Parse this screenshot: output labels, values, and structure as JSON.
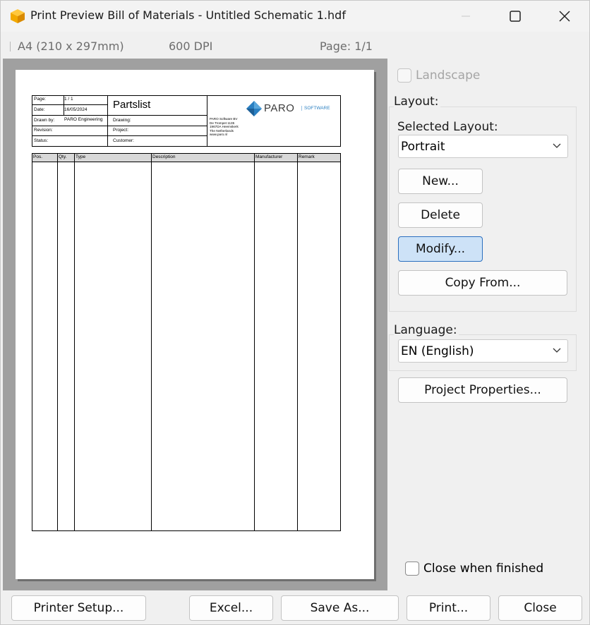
{
  "window": {
    "title": "Print Preview Bill of Materials - Untitled Schematic 1.hdf",
    "controls": {
      "minimize": "minimize-icon",
      "maximize": "maximize-icon",
      "close": "close-icon"
    }
  },
  "info": {
    "paper_size": "A4 (210 x 297mm)",
    "dpi": "600 DPI",
    "page": "Page: 1/1"
  },
  "preview": {
    "header": {
      "page_label": "Page:",
      "page_value": "1   / 1",
      "date_label": "Date:",
      "date_value": "16/05/2024",
      "drawn_label": "Drawn by:",
      "drawn_value": "PARO Engineering",
      "revision_label": "Revision:",
      "status_label": "Status:",
      "title": "Partslist",
      "drawing_label": "Drawing:",
      "project_label": "Project:",
      "customer_label": "Customer:",
      "logo_text": "PARO",
      "logo_sub": "SOFTWARE",
      "address": [
        "PARO Software BV",
        "De Trompet 1135",
        "1967DA Heemskerk",
        "The Netherlands",
        "www.paro.nl"
      ]
    },
    "columns": [
      "Pos.",
      "Qty.",
      "Type",
      "Description",
      "Manufacturer",
      "Remark"
    ]
  },
  "options": {
    "landscape_label": "Landscape",
    "landscape_checked": false,
    "layout_group": "Layout:",
    "selected_layout_label": "Selected Layout:",
    "selected_layout_value": "Portrait",
    "new_label": "New...",
    "delete_label": "Delete",
    "modify_label": "Modify...",
    "copy_from_label": "Copy From...",
    "language_group": "Language:",
    "language_value": "EN (English)",
    "project_properties_label": "Project Properties...",
    "close_when_finished_label": "Close when finished",
    "close_when_finished_checked": false
  },
  "footer": {
    "printer_setup": "Printer Setup...",
    "excel": "Excel...",
    "save_as": "Save As...",
    "print": "Print...",
    "close": "Close"
  },
  "colors": {
    "accent": "#2b6fbf",
    "focus_fill": "#cde2f7",
    "logo_blue": "#2a7fc1",
    "icon_orange": "#f2a900"
  }
}
